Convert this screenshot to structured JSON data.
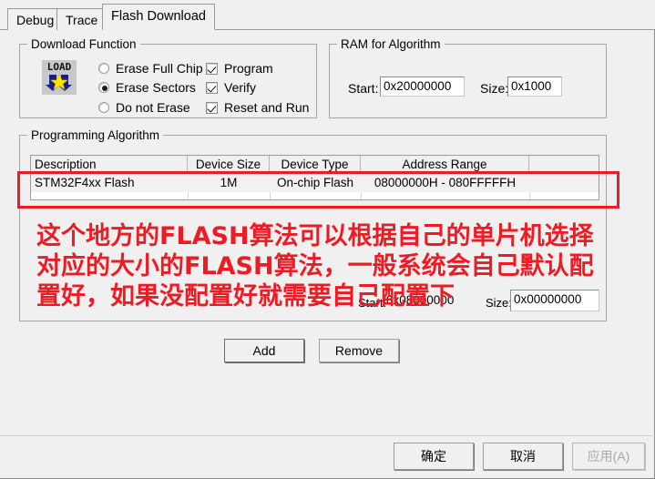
{
  "window": {
    "background_color": "#f0f0f0",
    "accent_red": "#ed1c24"
  },
  "tabs": [
    {
      "label": "Debug",
      "active": false
    },
    {
      "label": "Trace",
      "active": false
    },
    {
      "label": "Flash Download",
      "active": true
    }
  ],
  "download_function": {
    "legend": "Download Function",
    "icon_label": "LOAD",
    "erase_options": [
      {
        "label": "Erase Full Chip",
        "selected": false
      },
      {
        "label": "Erase Sectors",
        "selected": true
      },
      {
        "label": "Do not Erase",
        "selected": false
      }
    ],
    "checkboxes": [
      {
        "label": "Program",
        "checked": true
      },
      {
        "label": "Verify",
        "checked": true
      },
      {
        "label": "Reset and Run",
        "checked": true
      }
    ]
  },
  "ram_for_algorithm": {
    "legend": "RAM for Algorithm",
    "start_label": "Start:",
    "start_value": "0x20000000",
    "size_label": "Size:",
    "size_value": "0x1000"
  },
  "programming_algorithm": {
    "legend": "Programming Algorithm",
    "columns": [
      "Description",
      "Device Size",
      "Device Type",
      "Address Range"
    ],
    "rows": [
      {
        "description": "STM32F4xx Flash",
        "device_size": "1M",
        "device_type": "On-chip Flash",
        "address_range": "08000000H - 080FFFFFH",
        "selected": true
      }
    ],
    "start_label": "Start:",
    "start_value": "0x08000000",
    "size_label": "Size:",
    "size_value": "0x00000000",
    "add_button": "Add",
    "remove_button": "Remove"
  },
  "annotation": {
    "text": "这个地方的FLASH算法可以根据自己的单片机选择对应的大小的FLASH算法，一般系统会自己默认配置好，如果没配置好就需要自己配置下",
    "color": "#ed1c24"
  },
  "footer": {
    "ok_button": "确定",
    "cancel_button": "取消",
    "apply_button": "应用(A)"
  }
}
